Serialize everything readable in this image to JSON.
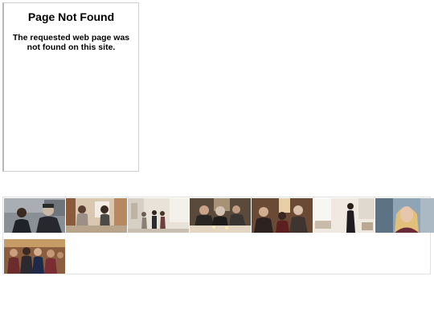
{
  "error_panel": {
    "title": "Page Not Found",
    "message": "The requested web page was not found on this site."
  },
  "gallery": {
    "thumbnails": [
      {
        "name": "photo-thumbnail-1",
        "description_icon": "photo-icon"
      },
      {
        "name": "photo-thumbnail-2",
        "description_icon": "photo-icon"
      },
      {
        "name": "photo-thumbnail-3",
        "description_icon": "photo-icon"
      },
      {
        "name": "photo-thumbnail-4",
        "description_icon": "photo-icon"
      },
      {
        "name": "photo-thumbnail-5",
        "description_icon": "photo-icon"
      },
      {
        "name": "photo-thumbnail-6",
        "description_icon": "photo-icon"
      },
      {
        "name": "photo-thumbnail-7",
        "description_icon": "photo-icon"
      },
      {
        "name": "photo-thumbnail-8",
        "description_icon": "photo-icon"
      }
    ]
  }
}
